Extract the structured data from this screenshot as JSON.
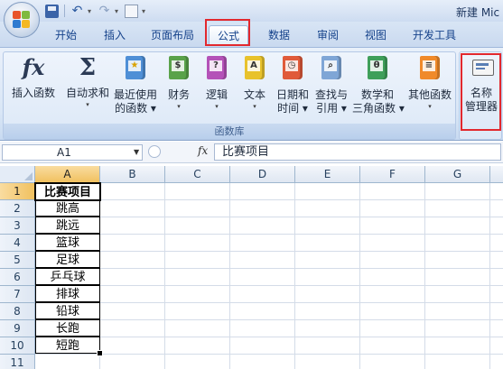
{
  "window": {
    "title": "新建 Mic"
  },
  "tabs": [
    {
      "label": "开始"
    },
    {
      "label": "插入"
    },
    {
      "label": "页面布局"
    },
    {
      "label": "公式",
      "active": true
    },
    {
      "label": "数据"
    },
    {
      "label": "审阅"
    },
    {
      "label": "视图"
    },
    {
      "label": "开发工具"
    }
  ],
  "ribbon": {
    "group_label": "函数库",
    "insert_function": "插入函数",
    "autosum": "自动求和",
    "recent_1": "最近使用",
    "recent_2": "的函数",
    "financial": "财务",
    "logical": "逻辑",
    "text": "文本",
    "datetime_1": "日期和",
    "datetime_2": "时间",
    "lookup_1": "查找与",
    "lookup_2": "引用",
    "math_1": "数学和",
    "math_2": "三角函数",
    "more": "其他函数",
    "name_manager_1": "名称",
    "name_manager_2": "管理器"
  },
  "formula_bar": {
    "name_box": "A1",
    "fx": "fx",
    "content": "比赛项目"
  },
  "grid": {
    "columns": [
      "A",
      "B",
      "C",
      "D",
      "E",
      "F",
      "G"
    ],
    "rows": [
      "1",
      "2",
      "3",
      "4",
      "5",
      "6",
      "7",
      "8",
      "9",
      "10",
      "11"
    ],
    "column_a": [
      "比赛项目",
      "跳高",
      "跳远",
      "篮球",
      "足球",
      "乒乓球",
      "排球",
      "铅球",
      "长跑",
      "短跑"
    ]
  },
  "colors": {
    "highlight_red": "#e2282e",
    "selected_header": "#f1c15f",
    "ribbon_text": "#15428b"
  }
}
